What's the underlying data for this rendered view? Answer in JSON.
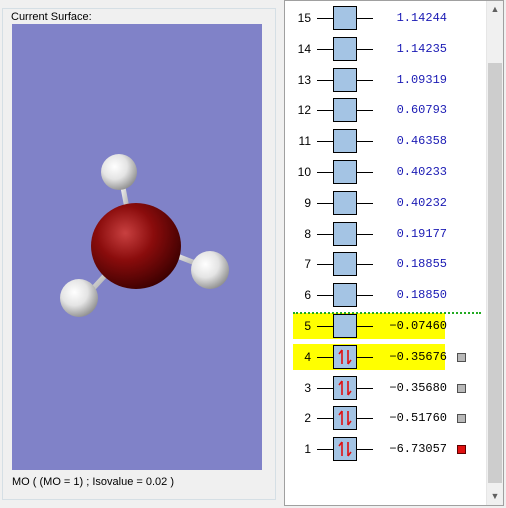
{
  "surface_group": {
    "title": "Current Surface:",
    "caption": "MO ( (MO = 1) ; Isovalue = 0.02 )"
  },
  "colors": {
    "viewport_bg": "#8082c8",
    "mo_box": "#a4c4e4",
    "highlight": "#ffff00",
    "energy_text": "#1a1ab4",
    "selected_marker": "#e01010"
  },
  "orbitals": [
    {
      "index": "15",
      "energy": "1.14244",
      "occupied": false,
      "highlight": false
    },
    {
      "index": "14",
      "energy": "1.14235",
      "occupied": false,
      "highlight": false
    },
    {
      "index": "13",
      "energy": "1.09319",
      "occupied": false,
      "highlight": false
    },
    {
      "index": "12",
      "energy": "0.60793",
      "occupied": false,
      "highlight": false
    },
    {
      "index": "11",
      "energy": "0.46358",
      "occupied": false,
      "highlight": false
    },
    {
      "index": "10",
      "energy": "0.40233",
      "occupied": false,
      "highlight": false
    },
    {
      "index": "9",
      "energy": "0.40232",
      "occupied": false,
      "highlight": false
    },
    {
      "index": "8",
      "energy": "0.19177",
      "occupied": false,
      "highlight": false
    },
    {
      "index": "7",
      "energy": "0.18855",
      "occupied": false,
      "highlight": false
    },
    {
      "index": "6",
      "energy": "0.18850",
      "occupied": false,
      "highlight": false
    },
    {
      "index": "5",
      "energy": "−0.07460",
      "occupied": false,
      "highlight": true
    },
    {
      "index": "4",
      "energy": "−0.35676",
      "occupied": true,
      "highlight": true,
      "marker": "gray"
    },
    {
      "index": "3",
      "energy": "−0.35680",
      "occupied": true,
      "highlight": false,
      "marker": "gray"
    },
    {
      "index": "2",
      "energy": "−0.51760",
      "occupied": true,
      "highlight": false,
      "marker": "gray"
    },
    {
      "index": "1",
      "energy": "−6.73057",
      "occupied": true,
      "highlight": false,
      "marker": "red"
    }
  ],
  "icons": {
    "scroll_up": "chevron-up-icon",
    "scroll_down": "chevron-down-icon",
    "spin_pair": "spin-up-down-icon"
  }
}
